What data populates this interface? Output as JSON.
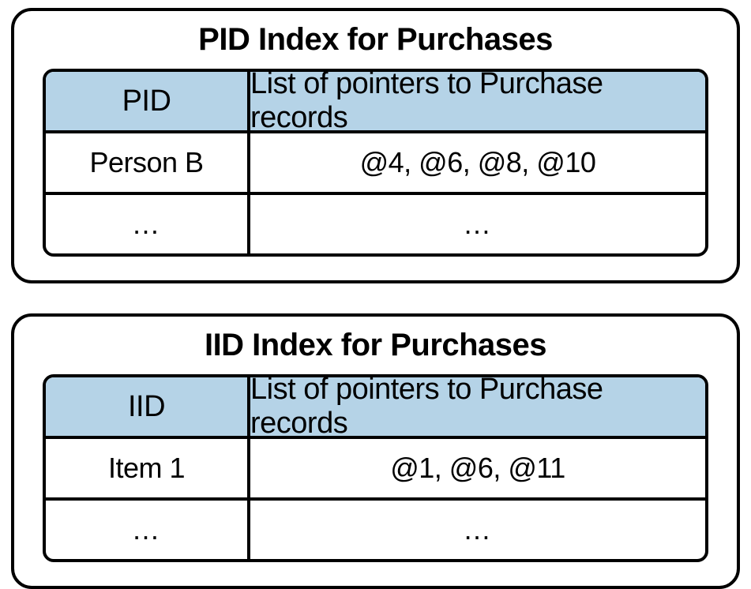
{
  "panels": [
    {
      "title": "PID Index for Purchases",
      "header": {
        "key": "PID",
        "val": "List of pointers to Purchase records"
      },
      "rows": [
        {
          "key": "Person B",
          "val": "@4, @6, @8, @10"
        },
        {
          "key": "…",
          "val": "…"
        }
      ]
    },
    {
      "title": "IID Index for Purchases",
      "header": {
        "key": "IID",
        "val": "List of pointers to Purchase records"
      },
      "rows": [
        {
          "key": "Item 1",
          "val": "@1, @6, @11"
        },
        {
          "key": "…",
          "val": "…"
        }
      ]
    }
  ]
}
